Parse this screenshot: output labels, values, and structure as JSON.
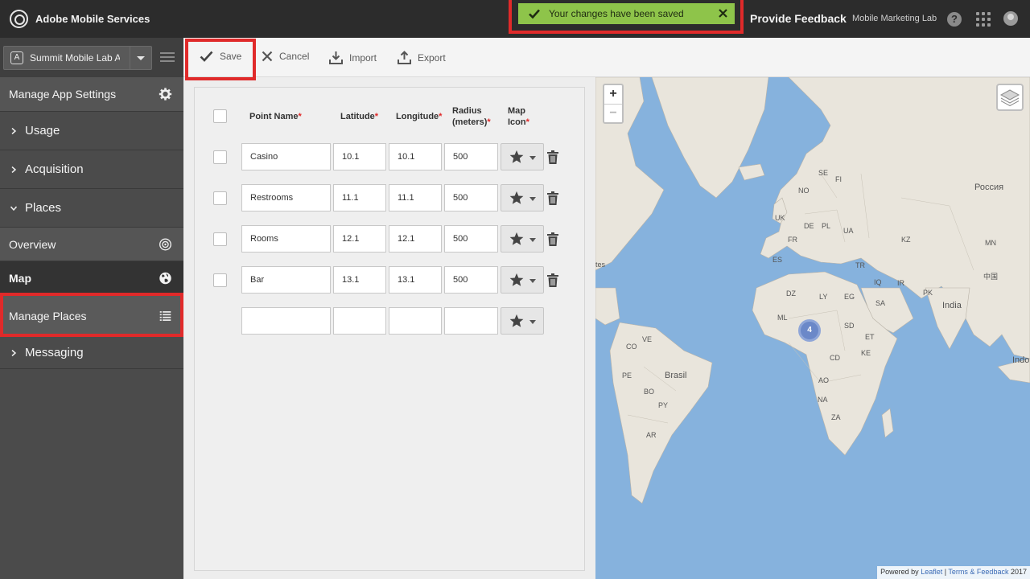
{
  "header": {
    "brand": "Adobe Mobile Services",
    "toast": "Your changes have been saved",
    "feedback": "Provide Feedback",
    "org": "Mobile Marketing Lab",
    "help": "?"
  },
  "sidebar": {
    "app_badge": "A",
    "app_name": "Summit Mobile Lab Ap",
    "manage_settings": "Manage App Settings",
    "items": [
      {
        "label": "Usage"
      },
      {
        "label": "Acquisition"
      },
      {
        "label": "Places"
      },
      {
        "label": "Overview"
      },
      {
        "label": "Map"
      },
      {
        "label": "Manage Places"
      },
      {
        "label": "Messaging"
      }
    ]
  },
  "toolbar": {
    "save": "Save",
    "cancel": "Cancel",
    "import": "Import",
    "export": "Export"
  },
  "table": {
    "headers": {
      "name": "Point Name",
      "lat": "Latitude",
      "lng": "Longitude",
      "radius_1": "Radius",
      "radius_2": "(meters)",
      "icon_1": "Map",
      "icon_2": "Icon",
      "required": "*"
    },
    "rows": [
      {
        "name": "Casino",
        "lat": "10.1",
        "lng": "10.1",
        "radius": "500"
      },
      {
        "name": "Restrooms",
        "lat": "11.1",
        "lng": "11.1",
        "radius": "500"
      },
      {
        "name": "Rooms",
        "lat": "12.1",
        "lng": "12.1",
        "radius": "500"
      },
      {
        "name": "Bar",
        "lat": "13.1",
        "lng": "13.1",
        "radius": "500"
      }
    ]
  },
  "map": {
    "zoom_in": "+",
    "zoom_out": "−",
    "cluster_count": "4",
    "labels": {
      "russia": "Россия",
      "se": "SE",
      "no": "NO",
      "fi": "FI",
      "uk": "UK",
      "de": "DE",
      "pl": "PL",
      "fr": "FR",
      "ua": "UA",
      "kz": "KZ",
      "mn": "MN",
      "es": "ES",
      "tr": "TR",
      "tes": "tes",
      "cn": "中国",
      "dz": "DZ",
      "ly": "LY",
      "eg": "EG",
      "iq": "IQ",
      "ir": "IR",
      "sa": "SA",
      "pk": "PK",
      "india": "India",
      "ml": "ML",
      "sd": "SD",
      "et": "ET",
      "ke": "KE",
      "cd": "CD",
      "co": "CO",
      "ve": "VE",
      "pe": "PE",
      "brasil": "Brasil",
      "bo": "BO",
      "py": "PY",
      "ar": "AR",
      "ao": "AO",
      "na": "NA",
      "za": "ZA",
      "indo": "Indo"
    },
    "attribution": {
      "prefix": "Powered by",
      "leaflet": "Leaflet",
      "sep": "|",
      "terms": "Terms & Feedback",
      "year": "2017"
    }
  }
}
